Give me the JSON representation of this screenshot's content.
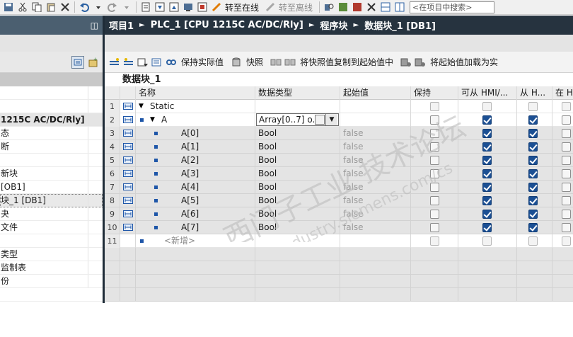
{
  "toolbar": {
    "go_online": "转至在线",
    "go_offline": "转至离线",
    "search_placeholder": "<在项目中搜索>"
  },
  "breadcrumb": [
    "项目1",
    "PLC_1 [CPU 1215C AC/DC/Rly]",
    "程序块",
    "数据块_1 [DB1]"
  ],
  "editor_toolbar": {
    "keep_actual": "保持实际值",
    "snapshot": "快照",
    "copy_snapshot": "将快照值复制到起始值中",
    "load_start": "将起始值加载为实"
  },
  "block_title": "数据块_1",
  "table": {
    "columns": [
      "名称",
      "数据类型",
      "起始值",
      "保持",
      "可从 HMI/...",
      "从 H...",
      "在 H"
    ],
    "rows": [
      {
        "num": "1",
        "name": "Static",
        "type": "",
        "start": "",
        "retain": false,
        "hmi1": false,
        "hmi2": false,
        "expander": true,
        "bullet": false,
        "indent": 0
      },
      {
        "num": "2",
        "name": "A",
        "type": "Array[0..7] o...",
        "start": "",
        "retain": false,
        "hmi1": true,
        "hmi2": true,
        "expander": true,
        "bullet": true,
        "indent": 1
      },
      {
        "num": "3",
        "name": "A[0]",
        "type": "Bool",
        "start": "false",
        "retain": false,
        "hmi1": true,
        "hmi2": true,
        "expander": false,
        "bullet": true,
        "indent": 2
      },
      {
        "num": "4",
        "name": "A[1]",
        "type": "Bool",
        "start": "false",
        "retain": false,
        "hmi1": true,
        "hmi2": true,
        "expander": false,
        "bullet": true,
        "indent": 2
      },
      {
        "num": "5",
        "name": "A[2]",
        "type": "Bool",
        "start": "false",
        "retain": false,
        "hmi1": true,
        "hmi2": true,
        "expander": false,
        "bullet": true,
        "indent": 2
      },
      {
        "num": "6",
        "name": "A[3]",
        "type": "Bool",
        "start": "false",
        "retain": false,
        "hmi1": true,
        "hmi2": true,
        "expander": false,
        "bullet": true,
        "indent": 2
      },
      {
        "num": "7",
        "name": "A[4]",
        "type": "Bool",
        "start": "false",
        "retain": false,
        "hmi1": true,
        "hmi2": true,
        "expander": false,
        "bullet": true,
        "indent": 2
      },
      {
        "num": "8",
        "name": "A[5]",
        "type": "Bool",
        "start": "false",
        "retain": false,
        "hmi1": true,
        "hmi2": true,
        "expander": false,
        "bullet": true,
        "indent": 2
      },
      {
        "num": "9",
        "name": "A[6]",
        "type": "Bool",
        "start": "false",
        "retain": false,
        "hmi1": true,
        "hmi2": true,
        "expander": false,
        "bullet": true,
        "indent": 2
      },
      {
        "num": "10",
        "name": "A[7]",
        "type": "Bool",
        "start": "false",
        "retain": false,
        "hmi1": true,
        "hmi2": true,
        "expander": false,
        "bullet": true,
        "indent": 2
      },
      {
        "num": "11",
        "name": "<新增>",
        "type": "",
        "start": "",
        "retain": false,
        "hmi1": false,
        "hmi2": false,
        "expander": false,
        "bullet": true,
        "indent": 0,
        "addnew": true
      }
    ]
  },
  "tree_rows": [
    {
      "label": "",
      "style": "plain"
    },
    {
      "label": "",
      "style": "plain"
    },
    {
      "label": "1215C AC/DC/Rly]",
      "style": "bold"
    },
    {
      "label": "态",
      "style": "plain"
    },
    {
      "label": "断",
      "style": "plain"
    },
    {
      "label": "",
      "style": "plain"
    },
    {
      "label": "新块",
      "style": "plain"
    },
    {
      "label": "[OB1]",
      "style": "plain"
    },
    {
      "label": "块_1 [DB1]",
      "style": "selected"
    },
    {
      "label": "夬",
      "style": "plain"
    },
    {
      "label": "文件",
      "style": "plain"
    },
    {
      "label": "",
      "style": "plain"
    },
    {
      "label": "类型",
      "style": "plain"
    },
    {
      "label": "监制表",
      "style": "plain"
    },
    {
      "label": "份",
      "style": "plain"
    }
  ],
  "colors": {
    "breadcrumb_bg": "#26333f",
    "checkbox_checked": "#1b4f93",
    "member_icon": "#1e56a8"
  },
  "watermark": {
    "line1": "西门子工业 技术论坛",
    "line2": "support.industry.siemens.com/cs"
  }
}
